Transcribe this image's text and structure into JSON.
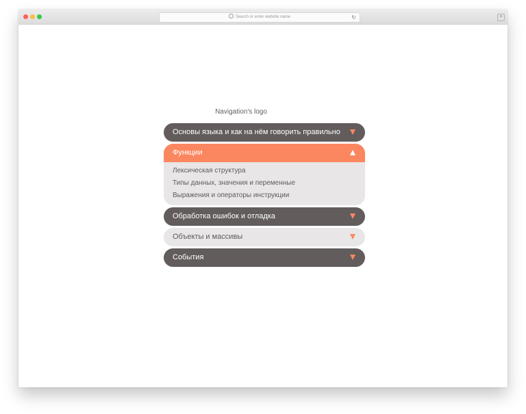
{
  "browser": {
    "address_placeholder": "Search or enter website name",
    "tab_button": "+"
  },
  "page": {
    "logo": "Navigation's logo"
  },
  "menu": {
    "items": [
      {
        "label": "Основы языка и как на нём говорить правильно",
        "state": "collapsed"
      },
      {
        "label": "Функции",
        "state": "expanded",
        "subitems": [
          "Лексическая структура",
          "Типы данных, значения и переменные",
          "Выражения и операторы инструкции"
        ]
      },
      {
        "label": "Обработка ошибок и отладка",
        "state": "collapsed"
      },
      {
        "label": "Объекты и массивы",
        "state": "collapsed"
      },
      {
        "label": "События",
        "state": "collapsed"
      }
    ]
  },
  "colors": {
    "dark_item": "#625c5d",
    "active_item": "#fb8761",
    "light_item": "#e8e6e6",
    "caret": "#fb8761"
  },
  "icons": {
    "collapsed": "caret-down-icon",
    "expanded": "caret-up-icon"
  }
}
